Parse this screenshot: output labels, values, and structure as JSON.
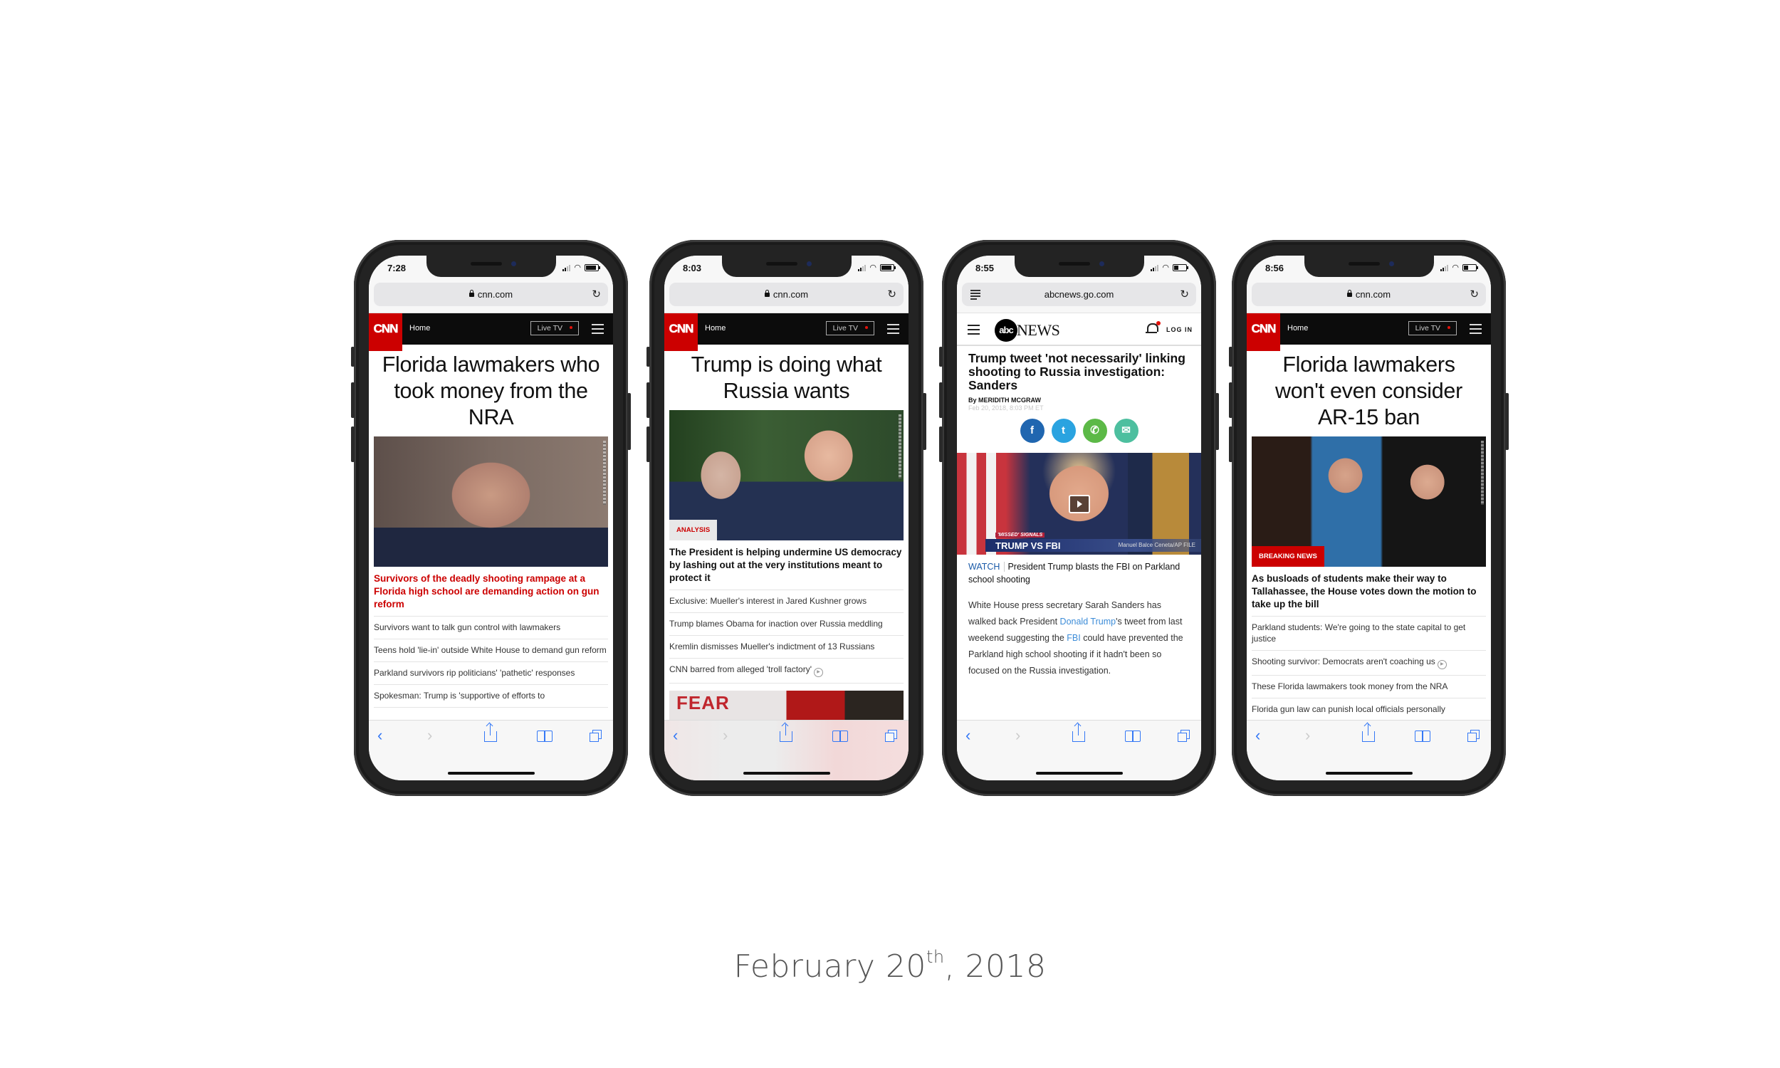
{
  "caption": {
    "month_day": "February 20",
    "suffix": "th",
    "year": ", 2018"
  },
  "phones": [
    {
      "site": "cnn",
      "status_time": "7:28",
      "battery_level": 0.9,
      "url": "cnn.com",
      "nav": {
        "home_label": "Home",
        "live_tv_label": "Live TV",
        "logo_text": "CNN"
      },
      "headline": "Florida lawmakers who took money from the NRA",
      "image_desc": "Marco Rubio portrait",
      "badge": "",
      "lead": "Survivors of the deadly shooting rampage at a Florida high school are demanding action on gun reform",
      "lead_color": "red",
      "links": [
        {
          "text": "Survivors want to talk gun control with lawmakers",
          "video": false
        },
        {
          "text": "Teens hold 'lie-in' outside White House to demand gun reform",
          "video": false
        },
        {
          "text": "Parkland survivors rip politicians' 'pathetic' responses",
          "video": false
        },
        {
          "text": "Spokesman: Trump is 'supportive of efforts to",
          "video": false
        }
      ]
    },
    {
      "site": "cnn",
      "status_time": "8:03",
      "battery_level": 0.9,
      "url": "cnn.com",
      "nav": {
        "home_label": "Home",
        "live_tv_label": "Live TV",
        "logo_text": "CNN"
      },
      "headline": "Trump is doing what Russia wants",
      "image_desc": "Putin and Trump talking",
      "badge": "ANALYSIS",
      "lead": "The President is helping undermine US democracy by lashing out at the very institutions meant to protect it",
      "lead_color": "black",
      "links": [
        {
          "text": "Exclusive: Mueller's interest in Jared Kushner grows",
          "video": false
        },
        {
          "text": "Trump blames Obama for inaction over Russia meddling",
          "video": false
        },
        {
          "text": "Kremlin dismisses Mueller's indictment of 13 Russians",
          "video": false
        },
        {
          "text": "CNN barred from alleged 'troll factory'",
          "video": true
        }
      ],
      "teaser_image_text": "FEAR"
    },
    {
      "site": "abc",
      "status_time": "8:55",
      "battery_level": 0.4,
      "url": "abcnews.go.com",
      "nav": {
        "logo_circle": "abc",
        "logo_word": "NEWS",
        "login_label": "LOG IN"
      },
      "headline": "Trump tweet 'not necessarily' linking shooting to Russia investigation: Sanders",
      "byline": "By MERIDITH MCGRAW",
      "dateline": "Feb 20, 2018, 8:03 PM ET",
      "share_buttons": [
        {
          "name": "facebook",
          "glyph": "f",
          "color": "#2066b0"
        },
        {
          "name": "twitter",
          "glyph": "t",
          "color": "#2aa3e0"
        },
        {
          "name": "whatsapp",
          "glyph": "✆",
          "color": "#5cb947"
        },
        {
          "name": "email",
          "glyph": "✉",
          "color": "#4dbf9f"
        }
      ],
      "video": {
        "tag": "'MISSED' SIGNALS",
        "title": "TRUMP VS FBI",
        "credit": "Manuel Balce Ceneta/AP FILE"
      },
      "watch_label": "WATCH",
      "watch_text": "President Trump blasts the FBI on Parkland school shooting",
      "body_parts": [
        {
          "text": "White House press secretary Sarah Sanders has walked back President ",
          "link": false
        },
        {
          "text": "Donald Trump",
          "link": true
        },
        {
          "text": "'s tweet from last weekend suggesting the ",
          "link": false
        },
        {
          "text": "FBI",
          "link": true
        },
        {
          "text": " could have prevented the Parkland high school shooting if it hadn't been so focused on the Russia investigation.",
          "link": false
        }
      ]
    },
    {
      "site": "cnn",
      "status_time": "8:56",
      "battery_level": 0.4,
      "url": "cnn.com",
      "nav": {
        "home_label": "Home",
        "live_tv_label": "Live TV",
        "logo_text": "CNN"
      },
      "headline": "Florida lawmakers won't even consider AR-15 ban",
      "image_desc": "Grieving students and parent",
      "badge": "BREAKING NEWS",
      "lead": "As busloads of students make their way to Tallahassee, the House votes down the motion to take up the bill",
      "lead_color": "black",
      "links": [
        {
          "text": "Parkland students: We're going to the state capital to get justice",
          "video": false
        },
        {
          "text": "Shooting survivor: Democrats aren't coaching us",
          "video": true
        },
        {
          "text": "These Florida lawmakers took money from the NRA",
          "video": false
        },
        {
          "text": "Florida gun law can punish local officials personally",
          "video": false
        }
      ]
    }
  ],
  "toolbar": {
    "back_icon": "chevron-left-icon",
    "forward_icon": "chevron-right-icon",
    "share_icon": "share-icon",
    "bookmarks_icon": "book-icon",
    "tabs_icon": "tabs-icon"
  },
  "colors": {
    "cnn_red": "#cc0000",
    "ios_blue": "#3478f6",
    "abc_link": "#3c8cd8",
    "phone_body": "#232323"
  }
}
